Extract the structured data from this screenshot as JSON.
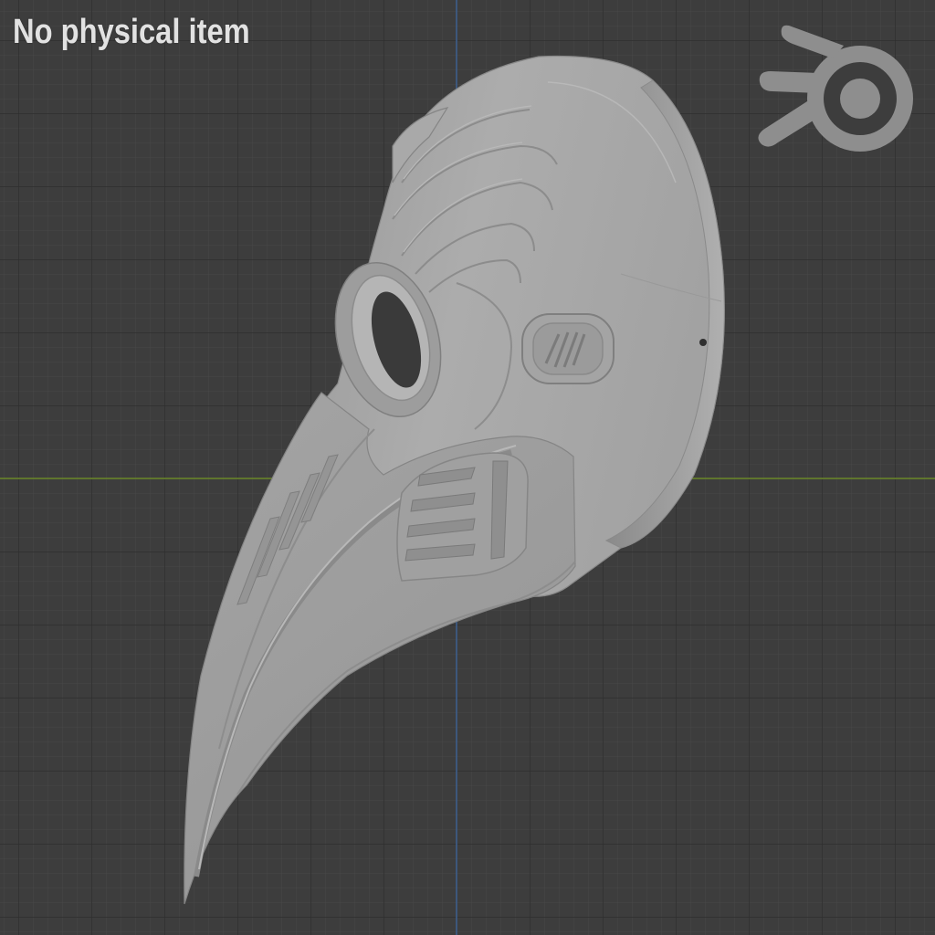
{
  "viewport": {
    "overlay_text": "No physical item",
    "background_color": "#3d3d3d",
    "grid_minor_color": "#474747",
    "grid_major_color": "#2c2c2c",
    "x_axis_color": "#6c8a2a",
    "y_axis_color": "#3e5f8c"
  },
  "model": {
    "name": "plague-doctor-mask",
    "surface_color": "#a7a7a7"
  },
  "logo": {
    "name": "blender-logo-icon",
    "color": "#8e8e8e"
  }
}
